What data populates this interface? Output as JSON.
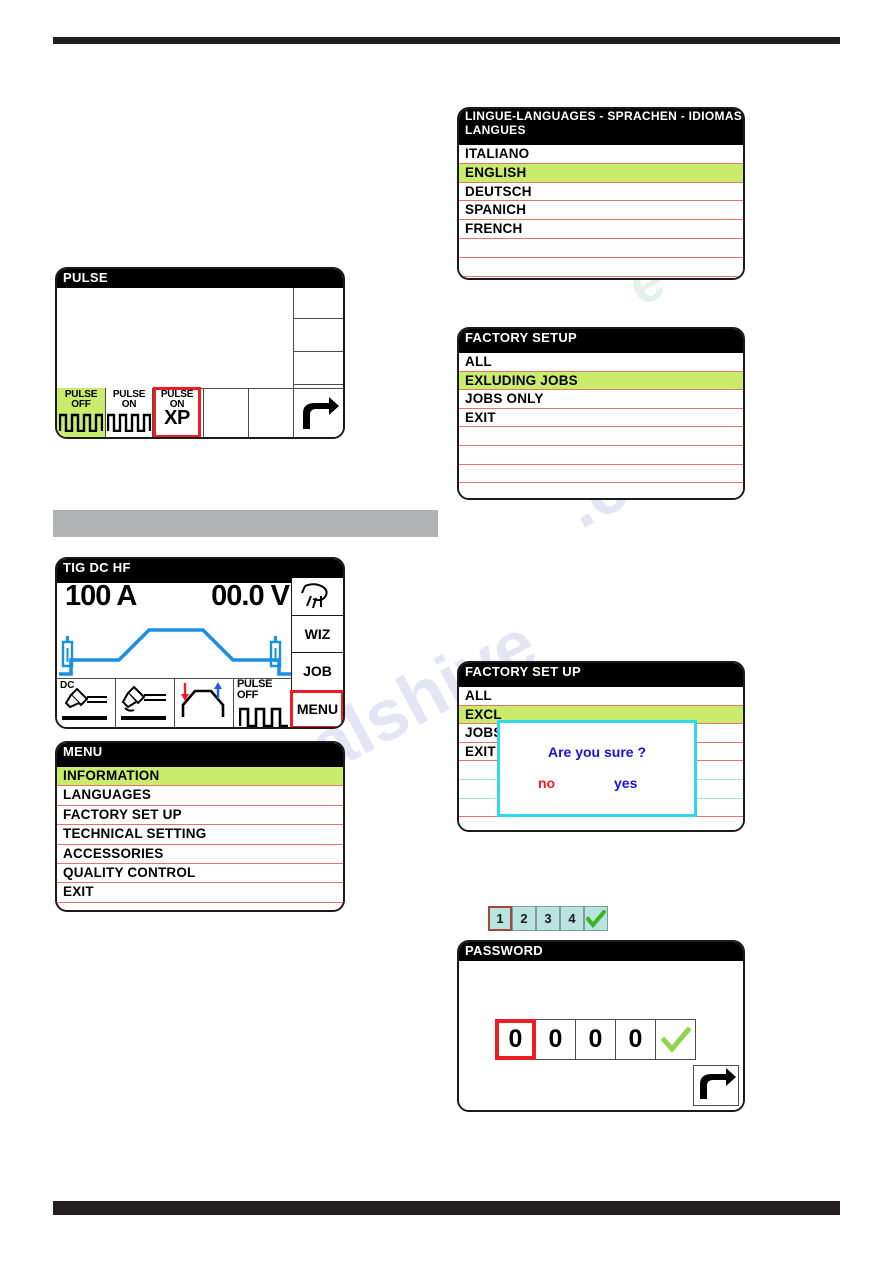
{
  "page": {
    "background": "#ffffff",
    "rule_color": "#231f20",
    "band_color": "#b0b2b4"
  },
  "colors": {
    "highlight_green": "#c9ec6d",
    "row_separator": "#e8736a",
    "selection_red": "#ee1c25",
    "dialog_border_cyan": "#2fd8ef",
    "dialog_text_blue": "#1412d8",
    "dialog_no_red": "#ee1c25",
    "chip_teal": "#b9e3de",
    "waveform_blue": "#1a8fe3",
    "check_green": "#8fd44a"
  },
  "pulse_screen": {
    "title": "PULSE",
    "buttons": [
      {
        "line1": "PULSE",
        "line2": "OFF",
        "xp": "",
        "selected_green": true,
        "outlined_red": false,
        "icon": "pulse-wave-icon"
      },
      {
        "line1": "PULSE",
        "line2": "ON",
        "xp": "",
        "selected_green": false,
        "outlined_red": false,
        "icon": "pulse-wave-icon"
      },
      {
        "line1": "PULSE",
        "line2": "ON",
        "xp": "XP",
        "selected_green": false,
        "outlined_red": true,
        "icon": "xp-text-icon"
      }
    ],
    "return_icon": "return-arrow-icon"
  },
  "tig_screen": {
    "title": "TIG DC HF",
    "current": "100 A",
    "voltage": "00.0 V",
    "waveform_icon": "weld-ramp-waveform",
    "gas_icon": "gas-bottle-icon",
    "bottom_cells": [
      {
        "label": "DC",
        "icon": "torch-dc-icon"
      },
      {
        "label": "",
        "icon": "torch-strike-icon"
      },
      {
        "label": "",
        "icon": "slope-up-down-icon"
      },
      {
        "label": "PULSE OFF",
        "label1": "PULSE",
        "label2": "OFF",
        "icon": "pulse-wave-icon"
      }
    ],
    "side_buttons": [
      {
        "label": "",
        "icon": "torch-icon",
        "outlined_red": false
      },
      {
        "label": "WIZ",
        "icon": "",
        "outlined_red": false
      },
      {
        "label": "JOB",
        "icon": "",
        "outlined_red": false
      },
      {
        "label": "MENU",
        "icon": "",
        "outlined_red": true
      }
    ]
  },
  "menu_screen": {
    "title": "MENU",
    "items": [
      {
        "label": "INFORMATION",
        "selected": true
      },
      {
        "label": "LANGUAGES",
        "selected": false
      },
      {
        "label": "FACTORY SET UP",
        "selected": false
      },
      {
        "label": "TECHNICAL SETTING",
        "selected": false
      },
      {
        "label": "ACCESSORIES",
        "selected": false
      },
      {
        "label": "QUALITY CONTROL",
        "selected": false
      },
      {
        "label": "EXIT",
        "selected": false
      }
    ]
  },
  "languages_screen": {
    "title_line1": "LINGUE-LANGUAGES - SPRACHEN - IDIOMAS",
    "title_line2": "LANGUES",
    "items": [
      {
        "label": "ITALIANO",
        "selected": false
      },
      {
        "label": "ENGLISH",
        "selected": true
      },
      {
        "label": "DEUTSCH",
        "selected": false
      },
      {
        "label": "SPANICH",
        "selected": false
      },
      {
        "label": "FRENCH",
        "selected": false
      },
      {
        "label": "",
        "selected": false
      },
      {
        "label": "",
        "selected": false
      }
    ]
  },
  "factory_setup_screen": {
    "title": "FACTORY SETUP",
    "items": [
      {
        "label": "ALL",
        "selected": false
      },
      {
        "label": "EXLUDING JOBS",
        "selected": true
      },
      {
        "label": "JOBS ONLY",
        "selected": false
      },
      {
        "label": "EXIT",
        "selected": false
      },
      {
        "label": "",
        "selected": false
      },
      {
        "label": "",
        "selected": false
      },
      {
        "label": "",
        "selected": false
      },
      {
        "label": "",
        "selected": false
      }
    ]
  },
  "factory_setup_confirm_screen": {
    "title": "FACTORY SET UP",
    "items": [
      {
        "label": "ALL",
        "selected": false
      },
      {
        "label": "EXCL",
        "selected": true
      },
      {
        "label": "JOBS",
        "selected": false
      },
      {
        "label": "EXIT",
        "selected": false
      },
      {
        "label": "",
        "selected": false
      },
      {
        "label": "",
        "selected": false
      },
      {
        "label": "",
        "selected": false
      },
      {
        "label": "",
        "selected": false
      }
    ],
    "dialog": {
      "question": "Are you sure ?",
      "no_label": "no",
      "yes_label": "yes"
    }
  },
  "password_screen": {
    "chips": [
      {
        "label": "1",
        "selected": true
      },
      {
        "label": "2",
        "selected": false
      },
      {
        "label": "3",
        "selected": false
      },
      {
        "label": "4",
        "selected": false
      },
      {
        "label": "",
        "selected": false,
        "icon": "check-icon"
      }
    ],
    "title": "PASSWORD",
    "digits": [
      {
        "value": "0",
        "selected": true
      },
      {
        "value": "0",
        "selected": false
      },
      {
        "value": "0",
        "selected": false
      },
      {
        "value": "0",
        "selected": false
      }
    ],
    "confirm_icon": "check-icon",
    "return_icon": "return-arrow-icon"
  },
  "watermark": {
    "text_a": "manualshive",
    "text_b": ".com"
  }
}
